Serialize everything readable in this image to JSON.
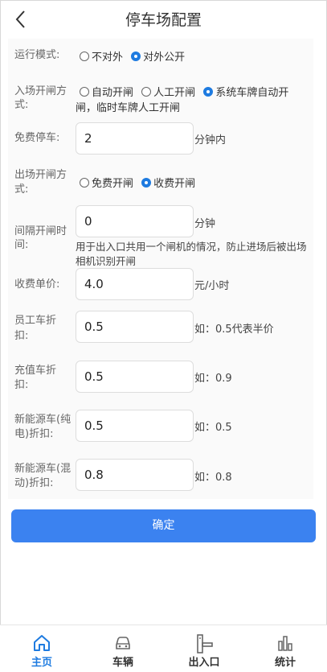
{
  "header": {
    "title": "停车场配置",
    "back_icon": "chevron-left-icon"
  },
  "run_mode": {
    "label": "运行模式:",
    "options": [
      {
        "label": "不对外",
        "selected": false
      },
      {
        "label": "对外公开",
        "selected": true
      }
    ]
  },
  "entry_gate": {
    "label_line1": "入场开闸方",
    "label_line2": "式:",
    "options": [
      {
        "label": "自动开闸",
        "selected": false
      },
      {
        "label": "人工开闸",
        "selected": false
      },
      {
        "label": "系统车牌自动开",
        "selected": true
      }
    ],
    "option_continuation": "闸，临时车牌人工开闸"
  },
  "free_parking": {
    "label": "免费停车:",
    "value": "2",
    "unit": "分钟内"
  },
  "exit_gate": {
    "label_line1": "出场开闸方",
    "label_line2": "式:",
    "options": [
      {
        "label": "免费开闸",
        "selected": false
      },
      {
        "label": "收费开闸",
        "selected": true
      }
    ]
  },
  "gate_interval": {
    "label_line1": "间隔开闸时",
    "label_line2": "间:",
    "value": "0",
    "unit": "分钟",
    "note": "用于出入口共用一个闸机的情况，防止进场后被出场相机识别开闸"
  },
  "unit_price": {
    "label": "收费单价:",
    "value": "4.0",
    "unit": "元/小时"
  },
  "staff_discount": {
    "label_line1": "员工车折",
    "label_line2": "扣:",
    "value": "0.5",
    "hint": "如：0.5代表半价"
  },
  "prepaid_discount": {
    "label_line1": "充值车折",
    "label_line2": "扣:",
    "value": "0.5",
    "hint": "如：0.9"
  },
  "ev_discount": {
    "label_line1": "新能源车(纯",
    "label_line2": "电)折扣:",
    "value": "0.5",
    "hint": "如：0.5"
  },
  "hybrid_discount": {
    "label_line1": "新能源车(混",
    "label_line2": "动)折扣:",
    "value": "0.8",
    "hint": "如：0.8"
  },
  "confirm_button": "确定",
  "tabbar": {
    "items": [
      {
        "label": "主页",
        "icon": "home-icon",
        "active": true
      },
      {
        "label": "车辆",
        "icon": "car-icon",
        "active": false
      },
      {
        "label": "出入口",
        "icon": "gate-icon",
        "active": false
      },
      {
        "label": "统计",
        "icon": "bar-chart-icon",
        "active": false
      }
    ]
  },
  "colors": {
    "accent": "#1e7be0",
    "button": "#3b82f0",
    "form_bg": "#fafafa"
  }
}
